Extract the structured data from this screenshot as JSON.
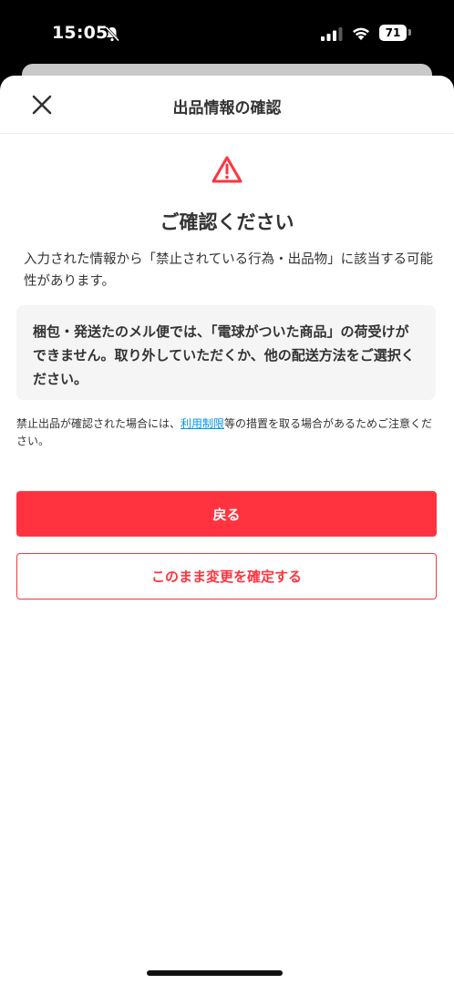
{
  "status_bar": {
    "time": "15:05",
    "battery": "71",
    "icons": [
      "bell-slash-icon",
      "signal-icon",
      "wifi-icon",
      "battery-icon"
    ]
  },
  "header": {
    "title": "出品情報の確認",
    "close_icon": "close-icon"
  },
  "dialog": {
    "warning_icon": "warning-triangle-icon",
    "heading": "ご確認ください",
    "intro": "入力された情報から「禁止されている行為・出品物」に該当する可能性があります。",
    "notice": "梱包・発送たのメル便では、「電球がついた商品」の荷受けができません。取り外していただくか、他の配送方法をご選択ください。",
    "footnote_before": "禁止出品が確認された場合には、",
    "footnote_link": "利用制限",
    "footnote_after": "等の措置を取る場合があるためご注意ください。"
  },
  "buttons": {
    "back_label": "戻る",
    "confirm_label": "このまま変更を確定する"
  },
  "colors": {
    "accent": "#ff333f",
    "link": "#0095ee",
    "text": "#333333",
    "notice_bg": "#f5f5f5"
  }
}
